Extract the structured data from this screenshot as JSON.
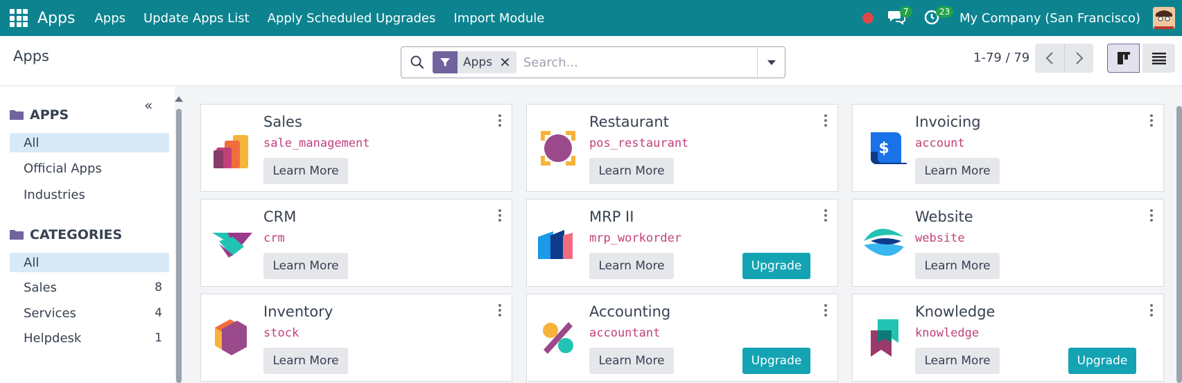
{
  "navbar": {
    "brand": "Apps",
    "menus": [
      "Apps",
      "Update Apps List",
      "Apply Scheduled Upgrades",
      "Import Module"
    ],
    "messages_count": "7",
    "activities_count": "23",
    "company": "My Company (San Francisco)",
    "accent_color": "#0d8390"
  },
  "control": {
    "title": "Apps",
    "facet_label": "Apps",
    "search_placeholder": "Search...",
    "pager": "1-79 / 79"
  },
  "sidebar": {
    "apps_heading": "APPS",
    "apps_items": [
      "All",
      "Official Apps",
      "Industries"
    ],
    "categories_heading": "CATEGORIES",
    "categories": [
      {
        "label": "All",
        "count": ""
      },
      {
        "label": "Sales",
        "count": "8"
      },
      {
        "label": "Services",
        "count": "4"
      },
      {
        "label": "Helpdesk",
        "count": "1"
      }
    ]
  },
  "cards": [
    {
      "title": "Sales",
      "module": "sale_management",
      "learn": "Learn More",
      "icon": "sales-icon"
    },
    {
      "title": "Restaurant",
      "module": "pos_restaurant",
      "learn": "Learn More",
      "icon": "restaurant-icon"
    },
    {
      "title": "Invoicing",
      "module": "account",
      "learn": "Learn More",
      "icon": "invoicing-icon"
    },
    {
      "title": "CRM",
      "module": "crm",
      "learn": "Learn More",
      "icon": "crm-icon"
    },
    {
      "title": "MRP II",
      "module": "mrp_workorder",
      "learn": "Learn More",
      "upgrade": "Upgrade",
      "icon": "mrp-icon"
    },
    {
      "title": "Website",
      "module": "website",
      "learn": "Learn More",
      "icon": "website-icon"
    },
    {
      "title": "Inventory",
      "module": "stock",
      "learn": "Learn More",
      "icon": "inventory-icon"
    },
    {
      "title": "Accounting",
      "module": "accountant",
      "learn": "Learn More",
      "upgrade": "Upgrade",
      "icon": "accounting-icon"
    },
    {
      "title": "Knowledge",
      "module": "knowledge",
      "learn": "Learn More",
      "upgrade": "Upgrade",
      "icon": "knowledge-icon"
    }
  ]
}
